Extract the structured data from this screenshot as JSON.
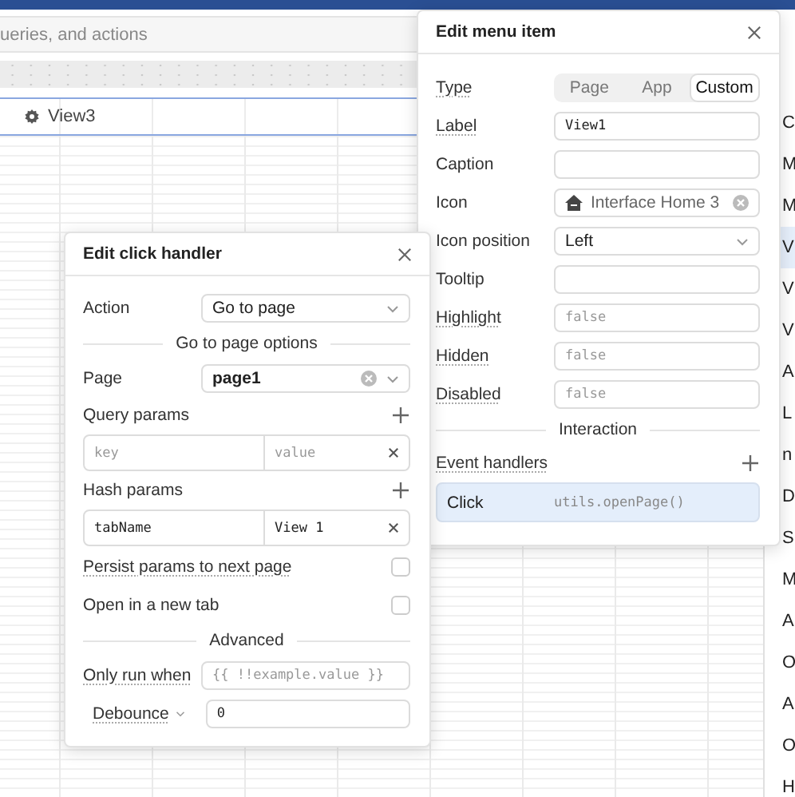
{
  "canvas": {
    "search": {
      "placeholder": "ueries, and actions"
    },
    "selected_row": {
      "label": "View3"
    }
  },
  "sidebar": {
    "items": [
      {
        "text": "C",
        "selected": false
      },
      {
        "text": "M",
        "selected": false
      },
      {
        "text": "M",
        "selected": false
      },
      {
        "text": "V",
        "selected": true
      },
      {
        "text": "V",
        "selected": false
      },
      {
        "text": "V",
        "selected": false
      },
      {
        "text": "A",
        "selected": false
      },
      {
        "text": "L",
        "selected": false
      },
      {
        "text": "n",
        "selected": false
      },
      {
        "text": "D",
        "selected": false
      },
      {
        "text": "S",
        "selected": false
      },
      {
        "text": "M",
        "selected": false
      },
      {
        "text": "A",
        "selected": false
      },
      {
        "text": "O",
        "selected": false
      },
      {
        "text": "A",
        "selected": false
      },
      {
        "text": "O",
        "selected": false
      },
      {
        "text": "H",
        "selected": false
      }
    ]
  },
  "menu_item_panel": {
    "title": "Edit menu item",
    "rows": [
      {
        "kind": "segmented",
        "label": "Type",
        "tooltip": true,
        "options": [
          {
            "label": "Page",
            "selected": false
          },
          {
            "label": "App",
            "selected": false
          },
          {
            "label": "Custom",
            "selected": true
          }
        ]
      },
      {
        "kind": "code",
        "label": "Label",
        "tooltip": true,
        "value": "View1"
      },
      {
        "kind": "code",
        "label": "Caption",
        "tooltip": false
      },
      {
        "kind": "icon_picker",
        "label": "Icon",
        "tooltip": false,
        "value": "Interface Home 3"
      },
      {
        "kind": "select",
        "label": "Icon position",
        "tooltip": false,
        "value": "Left"
      },
      {
        "kind": "code",
        "label": "Tooltip",
        "tooltip": false
      },
      {
        "kind": "code",
        "label": "Highlight",
        "tooltip": true,
        "placeholder": "false"
      },
      {
        "kind": "code",
        "label": "Hidden",
        "tooltip": true,
        "placeholder": "false"
      },
      {
        "kind": "code",
        "label": "Disabled",
        "tooltip": true,
        "placeholder": "false"
      },
      {
        "kind": "divider",
        "label": "Interaction"
      },
      {
        "kind": "list_header",
        "label": "Event handlers",
        "tooltip": true
      },
      {
        "kind": "handler",
        "event": "Click",
        "action": "utils.openPage()",
        "selected": true
      }
    ]
  },
  "click_handler_panel": {
    "title": "Edit click handler",
    "rows": [
      {
        "kind": "select",
        "label": "Action",
        "tooltip": false,
        "value": "Go to page"
      },
      {
        "kind": "divider",
        "label": "Go to page options"
      },
      {
        "kind": "combo",
        "label": "Page",
        "tooltip": false,
        "value": "page1"
      },
      {
        "kind": "list_header",
        "label": "Query params",
        "tooltip": false
      },
      {
        "kind": "kv",
        "key": {
          "placeholder": "key"
        },
        "value": {
          "placeholder": "value"
        }
      },
      {
        "kind": "list_header",
        "label": "Hash params",
        "tooltip": false
      },
      {
        "kind": "kv",
        "key": {
          "value": "tabName"
        },
        "value": {
          "value": "View 1"
        }
      },
      {
        "kind": "checkbox",
        "label": "Persist params to next page",
        "tooltip": true,
        "checked": false
      },
      {
        "kind": "checkbox",
        "label": "Open in a new tab",
        "tooltip": false,
        "checked": false
      },
      {
        "kind": "divider",
        "label": "Advanced"
      },
      {
        "kind": "code",
        "label": "Only run when",
        "tooltip": true,
        "placeholder": "{{ !!example.value }}"
      },
      {
        "kind": "menu_field",
        "label": "Debounce",
        "tooltip": true,
        "value": "0"
      }
    ]
  }
}
